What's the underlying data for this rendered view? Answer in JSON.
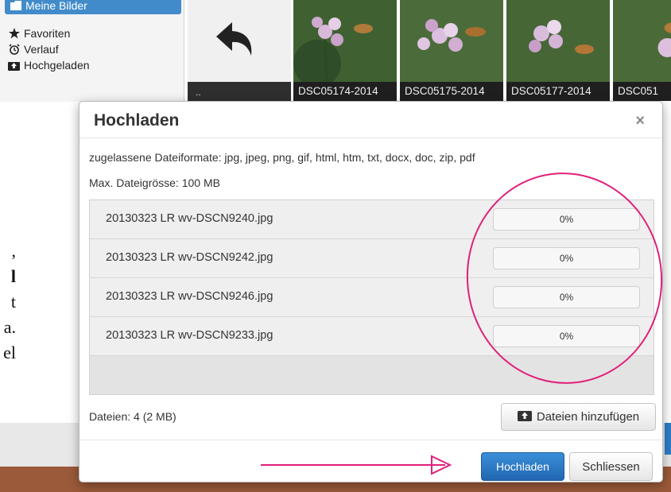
{
  "sidebar": {
    "items": [
      {
        "label": "Meine Bilder",
        "icon": "folder-icon"
      },
      {
        "label": "Favoriten",
        "icon": "star-icon"
      },
      {
        "label": "Verlauf",
        "icon": "alarm-clock-icon"
      },
      {
        "label": "Hochgeladen",
        "icon": "upload-icon"
      }
    ]
  },
  "gallery": {
    "back_caption": "..",
    "thumbnails": [
      {
        "caption": "DSC05174-2014"
      },
      {
        "caption": "DSC05175-2014"
      },
      {
        "caption": "DSC05177-2014"
      },
      {
        "caption": "DSC051"
      }
    ]
  },
  "background_text": [
    ",",
    "l",
    "t",
    "a.",
    "el"
  ],
  "modal": {
    "title": "Hochladen",
    "close_symbol": "×",
    "formats_text": "zugelassene Dateiformate: jpg, jpeg, png, gif, html, htm, txt, docx, doc, zip, pdf",
    "max_size_text": "Max. Dateigrösse: 100 MB",
    "files": [
      {
        "name": "20130323 LR wv-DSCN9240.jpg",
        "progress_label": "0%",
        "progress": 0
      },
      {
        "name": "20130323 LR wv-DSCN9242.jpg",
        "progress_label": "0%",
        "progress": 0
      },
      {
        "name": "20130323 LR wv-DSCN9246.jpg",
        "progress_label": "0%",
        "progress": 0
      },
      {
        "name": "20130323 LR wv-DSCN9233.jpg",
        "progress_label": "0%",
        "progress": 0
      }
    ],
    "file_count_text": "Dateien: 4 (2 MB)",
    "add_files_label": "Dateien hinzufügen",
    "upload_button_label": "Hochladen",
    "close_button_label": "Schliessen"
  },
  "colors": {
    "primary": "#2a7dc8",
    "annotation": "#e0207a",
    "progress_fill": "#5cb85c"
  }
}
